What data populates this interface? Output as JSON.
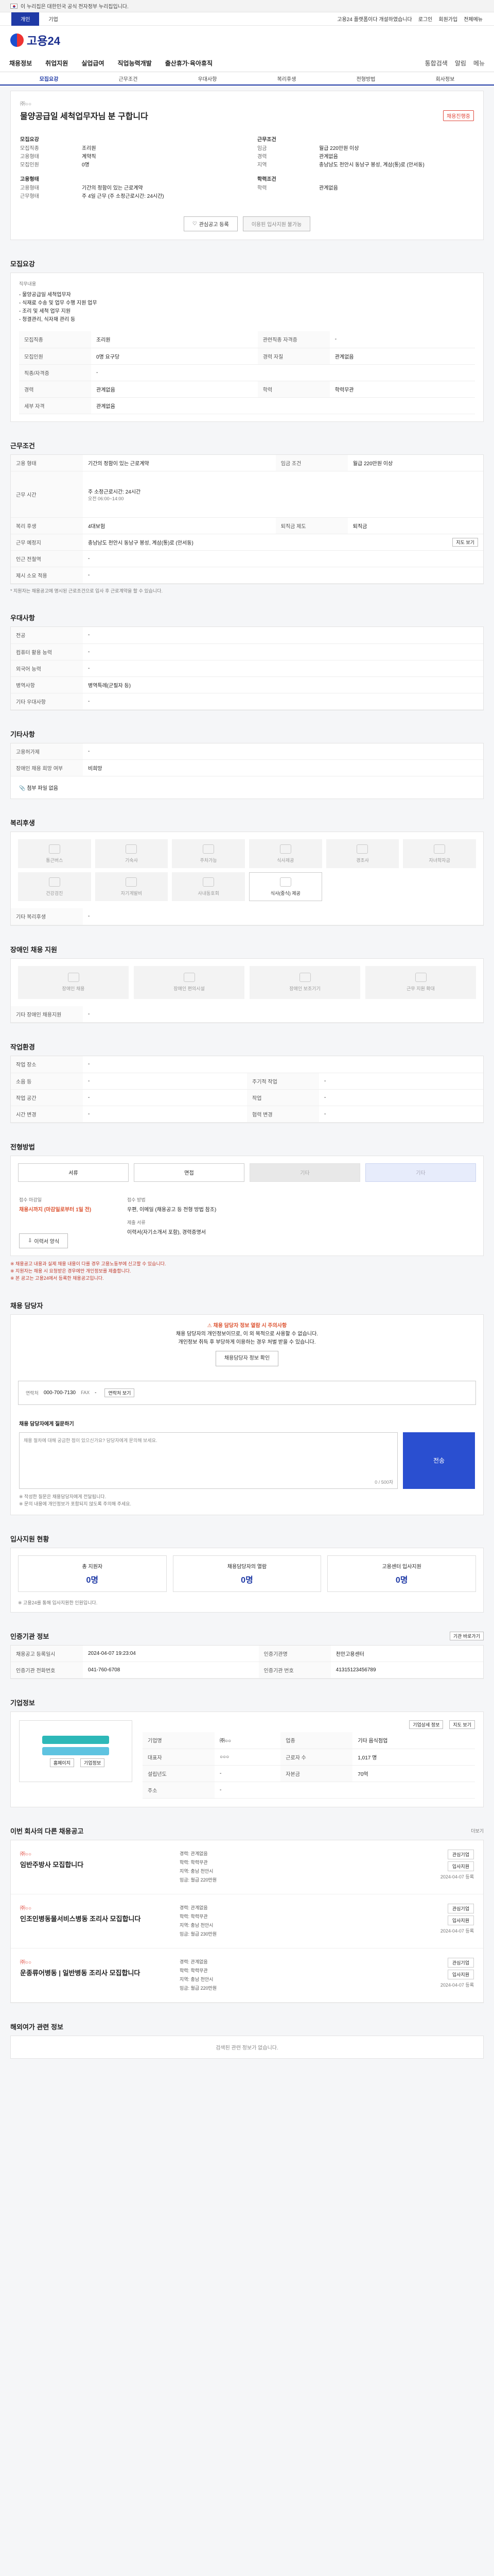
{
  "gov_bar": {
    "text": "이 누리집은 대한민국 공식 전자정부 누리집입니다."
  },
  "top": {
    "tabs": [
      "개인",
      "기업"
    ],
    "right": [
      "고용24 플랫폼이다 개설하였습니다",
      "로그인",
      "회원가입",
      "전체메뉴"
    ]
  },
  "logo": {
    "text": "고용24"
  },
  "gnb": {
    "items": [
      "채용정보",
      "취업지원",
      "실업급여",
      "직업능력개발",
      "출산휴가·육아휴직"
    ],
    "right": [
      "통합검색",
      "알림",
      "메뉴"
    ]
  },
  "subtabs": [
    "모집요강",
    "근무조건",
    "우대사항",
    "복리후생",
    "전형방법",
    "회사정보"
  ],
  "title": {
    "top": "㈜○○",
    "headline": "물양공급일 세척업무자님 분 구합니다",
    "badge": "채용진행중"
  },
  "summary": {
    "left": [
      {
        "section": "모집요강",
        "rows": [
          [
            "모집직종",
            "조리원"
          ],
          [
            "고용형태",
            "계약직"
          ],
          [
            "모집인원",
            "0명"
          ]
        ]
      },
      {
        "section": "고용형태",
        "rows": [
          [
            "고용형태",
            "기간의 정함이 있는 근로계약"
          ],
          [
            "근무형태",
            "주 4일 근무 (주 소정근로시간: 24시간)"
          ]
        ]
      }
    ],
    "right": [
      {
        "section": "근무조건",
        "rows": [
          [
            "임금",
            "월급 220만원 이상"
          ],
          [
            "경력",
            "관계없음"
          ],
          [
            "지역",
            "충남남도 천안시 동남구 봉성, 계삼(통)로 (안서동)"
          ]
        ]
      },
      {
        "section": "학력조건",
        "rows": [
          [
            "학력",
            "관계없음"
          ]
        ]
      }
    ],
    "buttons": {
      "interest": "관심공고 등록",
      "apply": "이용된 입사지원 불가능"
    }
  },
  "requirements": {
    "title": "모집요강",
    "duty_label": "직무내용",
    "duty_text": [
      "- 물양공급일 세척업무자",
      "- 식재료 수송 및 업무 수행 지원 업무",
      "- 조리 및 세척 업무 지원",
      "- 청결관리, 식자재 관리 등"
    ],
    "rows": [
      [
        "모집직종",
        "조리원",
        "관련직종 자격증",
        "-"
      ],
      [
        "모집인원",
        "0명 요구당",
        "경력 자질",
        "관계없음"
      ],
      [
        "직종/자격증",
        "-",
        "",
        ""
      ],
      [
        "경력",
        "관계없음",
        "학력",
        "학력무관"
      ],
      [
        "세부 자격",
        "관계없음",
        "",
        ""
      ]
    ]
  },
  "conditions": {
    "title": "근무조건",
    "rows": [
      [
        "고용 형태",
        "기간의 정함이 있는 근로계약",
        "임금 조건",
        "월급 220만원 이상"
      ],
      [
        "근무 시간",
        "주 소정근로시간: 24시간",
        "근무 형태",
        "주 4일 근무"
      ],
      [
        "복리 후생",
        "4대보험",
        "퇴직금 제도",
        "퇴직금"
      ],
      [
        "근무 예정지",
        "충남남도 천안시 동남구 봉성, 계삼(통)로 (안서동)",
        "",
        ""
      ],
      [
        "인근 전철역",
        "-",
        "",
        ""
      ],
      [
        "제시 소요 적용",
        "-",
        "",
        ""
      ]
    ],
    "work_time": "오전 06:00~14:00",
    "map_button": "지도 보기",
    "note": "* 지원자는 채용공고에 명시된 근로조건으로 입사 후 근로계약을 할 수 있습니다."
  },
  "preference": {
    "title": "우대사항",
    "rows": [
      [
        "전공",
        "-"
      ],
      [
        "컴퓨터 활용 능력",
        "-"
      ],
      [
        "외국어 능력",
        "-"
      ],
      [
        "병역사항",
        "병역특례(군필자 등)"
      ],
      [
        "기타 우대사항",
        "-"
      ]
    ]
  },
  "etc": {
    "title": "기타사항",
    "rows": [
      [
        "고용허가제",
        "-"
      ],
      [
        "장애인 채용 희망 여부",
        "비희망"
      ]
    ],
    "attach": "첨부 파일 없음"
  },
  "welfare": {
    "title": "복리후생",
    "icons": [
      "통근버스",
      "기숙사",
      "주차가능",
      "식사제공",
      "경조사",
      "자녀학자금",
      "건강검진",
      "자기계발비",
      "사내동호회",
      "의료지원금"
    ],
    "active": "식사(중식) 제공",
    "other_label": "기타 복리후생",
    "other_value": "-"
  },
  "disability": {
    "title": "장애인 채용 지원",
    "items": [
      "장애인 채용",
      "장애인 편의시설",
      "장애인 보조기기",
      "근무 지원 확대"
    ],
    "other_label": "기타 장애인 채용지원",
    "other_value": "-"
  },
  "workenv": {
    "title": "작업환경",
    "rows": [
      [
        "작업 장소",
        "-",
        "",
        ""
      ],
      [
        "소음 등",
        "-",
        "주기적 작업",
        "-"
      ],
      [
        "작업 공간",
        "-",
        "작업",
        "-"
      ],
      [
        "시간 변경",
        "-",
        "협력 변경",
        "-"
      ]
    ]
  },
  "process": {
    "title": "전형방법",
    "steps": [
      "서류",
      "면접",
      "기타",
      "기타"
    ],
    "method_label": "접수 마감일",
    "method_value": "채용시까지 (마감일로부터 1일 전)",
    "apply_label": "접수 방법",
    "apply_value": "우편, 이메일 (채용공고 등 전형 방법 참조)",
    "docs_label": "제출 서류",
    "docs_value": "이력서(자기소개서 포함), 경력증명서",
    "download_button": "이력서 양식",
    "notes": [
      "※ 채용공고 내용과 실제 채용 내용이 다를 경우 고용노동부에 신고할 수 있습니다.",
      "※ 지원자는 채용 시 요청받은 경우에만 개인정보를 제출합니다.",
      "※ 본 공고는 고용24에서 등록한 채용공고입니다."
    ]
  },
  "manager": {
    "title": "채용 담당자",
    "warn": "채용 담당자 정보 열람 시 주의사항",
    "lines": [
      "채용 담당자의 개인정보이므로, 이 외 목적으로 사용할 수 없습니다.",
      "개인정보 취득 후 부당하게 이용하는 경우 처벌 받을 수 있습니다."
    ],
    "contact_label": "연락처",
    "contact_value": "000-700-7130",
    "fax_label": "FAX",
    "fax_value": "-",
    "view_button": "연락처 보기",
    "open_button": "채용담당자 정보 확인",
    "q_label": "채용 담당자에게 질문하기",
    "q_placeholder": "채용 절차에 대해 궁금한 점이 있으신가요? 담당자에게 문의해 보세요.",
    "q_count": "0 / 500자",
    "send": "전송",
    "q_notes": [
      "※ 작성한 질문은 채용담당자에게 전달됩니다.",
      "※ 문의 내용에 개인정보가 포함되지 않도록 주의해 주세요."
    ]
  },
  "applicants": {
    "title": "입사지원 현황",
    "cards": [
      [
        "총 지원자",
        "0명"
      ],
      [
        "채용담당자의 열람",
        "0명"
      ],
      [
        "고용센터 입사지원",
        "0명"
      ]
    ],
    "note": "※ 고용24를 통해 입사지원한 인원입니다."
  },
  "agency": {
    "title": "인증기관 정보",
    "button": "기관 바로가기",
    "rows": [
      [
        "채용공고 등록일시",
        "2024-04-07 19:23:04",
        "인증기관명",
        "천안고용센터"
      ],
      [
        "인증기관 전화번호",
        "041-760-6708",
        "인증기관 번호",
        "41315123456789"
      ]
    ]
  },
  "company": {
    "title": "기업정보",
    "map_button": "지도 보기",
    "rows": [
      [
        "기업명",
        "㈜○○",
        "업종",
        "기타 음식점업"
      ],
      [
        "대표자",
        "○○○",
        "근로자 수",
        "1,017 명"
      ],
      [
        "설립년도",
        "-",
        "자본금",
        "70억"
      ],
      [
        "주소",
        "-",
        "",
        ""
      ]
    ],
    "links": [
      "홈페이지",
      "기업정보"
    ],
    "detail_button": "기업상세 정보"
  },
  "similar": {
    "title": "이번 회사의 다른 채용공고",
    "more": "더보기",
    "jobs": [
      {
        "org": "㈜○○",
        "title": "임반주방사 모집합니다",
        "meta": [
          "경력: 관계없음",
          "학력: 학력무관",
          "지역: 충남 천안시",
          "임금: 월급 220만원"
        ],
        "date": "2024-04-07 등록"
      },
      {
        "org": "㈜○○",
        "title": "인조인병동물서비스병동 조리사 모집합니다",
        "meta": [
          "경력: 관계없음",
          "학력: 학력무관",
          "지역: 충남 천안시",
          "임금: 월급 230만원"
        ],
        "date": "2024-04-07 등록"
      },
      {
        "org": "㈜○○",
        "title": "운종류어병동 | 일반병동 조리사 모집합니다",
        "meta": [
          "경력: 관계없음",
          "학력: 학력무관",
          "지역: 충남 천안시",
          "임금: 월급 220만원"
        ],
        "date": "2024-04-07 등록"
      }
    ],
    "actions": [
      "관심기업",
      "입사지원"
    ]
  },
  "more_info": {
    "title": "해외여가 관련 정보",
    "text": "검색된 관련 정보가 없습니다."
  },
  "colors": {
    "primary": "#1f3aa6",
    "accent": "#e0463a"
  }
}
